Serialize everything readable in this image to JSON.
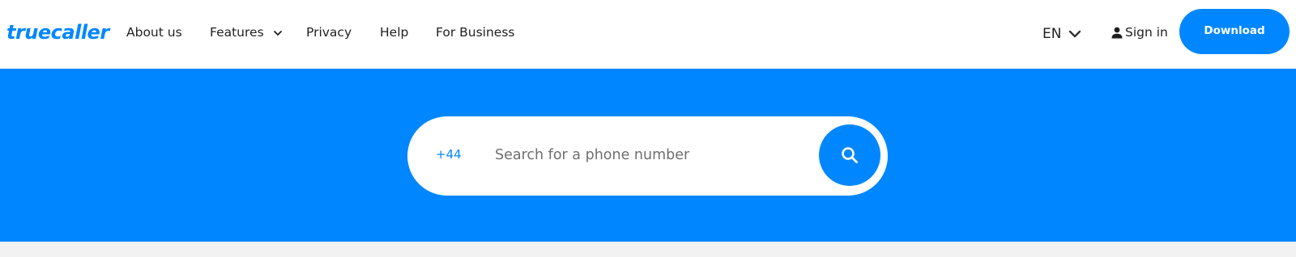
{
  "header": {
    "logo_text": "truecaller",
    "nav": {
      "about": "About us",
      "features": "Features",
      "privacy": "Privacy",
      "help": "Help",
      "business": "For Business"
    },
    "language": "EN",
    "sign_in": "Sign in",
    "download": "Download"
  },
  "search": {
    "country_code": "+44",
    "placeholder": "Search for a phone number",
    "value": ""
  },
  "colors": {
    "brand_blue": "#0087ff",
    "text_dark": "#1f1f1f",
    "background_gray": "#f2f2f2"
  },
  "icons": {
    "features_dropdown": "chevron-down-icon",
    "language_dropdown": "chevron-down-icon",
    "sign_in": "user-icon",
    "search": "search-icon"
  }
}
